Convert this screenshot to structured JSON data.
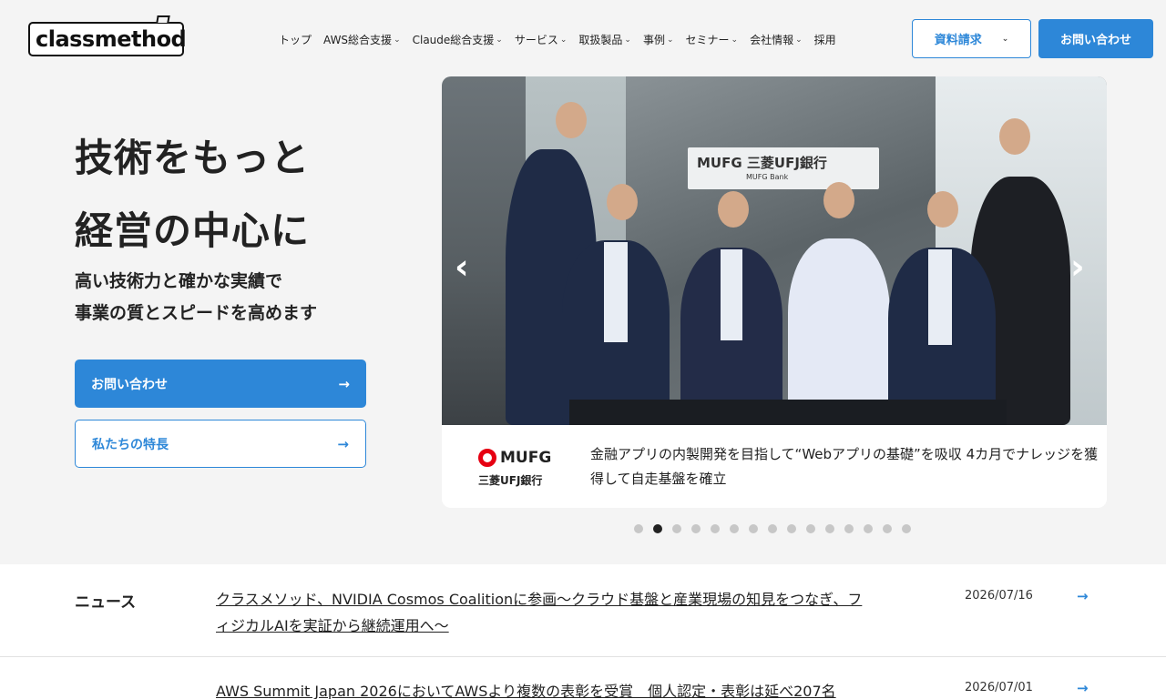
{
  "header": {
    "logo_text": "classmethod",
    "nav": [
      {
        "label": "トップ",
        "has_dropdown": false
      },
      {
        "label": "AWS総合支援",
        "has_dropdown": true
      },
      {
        "label": "Claude総合支援",
        "has_dropdown": true
      },
      {
        "label": "サービス",
        "has_dropdown": true
      },
      {
        "label": "取扱製品",
        "has_dropdown": true
      },
      {
        "label": "事例",
        "has_dropdown": true
      },
      {
        "label": "セミナー",
        "has_dropdown": true
      },
      {
        "label": "会社情報",
        "has_dropdown": true
      },
      {
        "label": "採用",
        "has_dropdown": false
      }
    ],
    "doc_request_label": "資料請求",
    "contact_label": "お問い合わせ"
  },
  "hero": {
    "title_line1": "技術をもっと",
    "title_line2": "経営の中心に",
    "sub_line1": "高い技術力と確かな実績で",
    "sub_line2": "事業の質とスピードを高めます",
    "cta_primary": "お問い合わせ",
    "cta_secondary": "私たちの特長",
    "arrow_glyph": "→"
  },
  "carousel": {
    "sign_text": "MUFG 三菱UFJ銀行",
    "sign_sub": "MUFG Bank",
    "logo_en": "MUFG",
    "logo_jp": "三菱UFJ銀行",
    "caption": "金融アプリの内製開発を目指して“Webアプリの基礎”を吸収 4カ月でナレッジを獲得して自走基盤を確立",
    "prev_glyph": "‹",
    "next_glyph": "›",
    "dot_count": 15,
    "active_index": 1
  },
  "news": {
    "label": "ニュース",
    "items": [
      {
        "title": "クラスメソッド、NVIDIA Cosmos Coalitionに参画〜クラウド基盤と産業現場の知見をつなぎ、フィジカルAIを実証から継続運用へ〜",
        "date": "2026/07/16"
      },
      {
        "title": "AWS Summit Japan 2026においてAWSより複数の表彰を受賞　個人認定・表彰は延べ207名",
        "date": "2026/07/01"
      }
    ]
  },
  "colors": {
    "accent": "#2d87d8",
    "background": "#f4f4f4",
    "mufg_red": "#e60012"
  },
  "icons": {
    "dropdown": "chevron-down-icon",
    "arrow": "arrow-right-icon",
    "prev": "chevron-left-icon",
    "next": "chevron-right-icon"
  }
}
